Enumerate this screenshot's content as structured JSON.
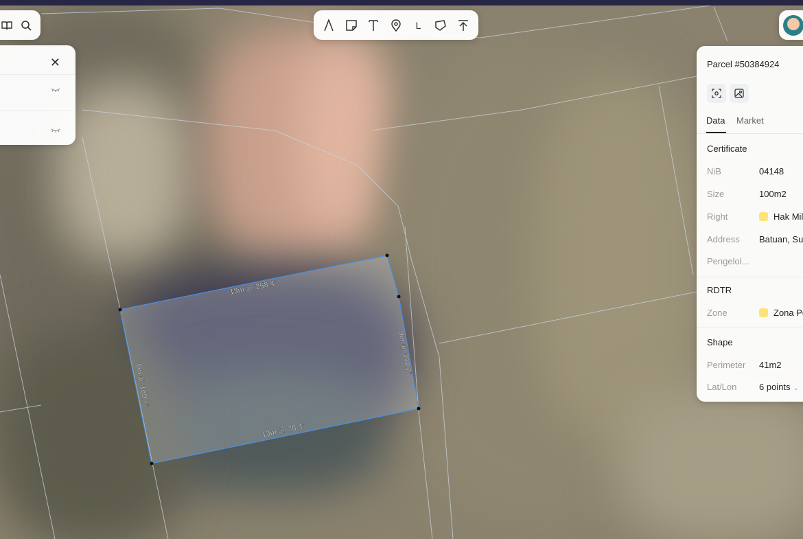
{
  "toolbar": {
    "tools": [
      "freehand-tool",
      "note-tool",
      "text-tool",
      "pin-tool",
      "line-tool",
      "polygon-tool",
      "upload-tool"
    ],
    "line_label": "L"
  },
  "polygon": {
    "top_edge_label": "13m @ 258.4°",
    "right_edge_label": "9m @ 349.7°",
    "bottom_edge_label": "13m @ 78.4°",
    "left_edge_label": "9m @ 169.7°"
  },
  "parcel": {
    "title": "Parcel #50384924",
    "tabs": [
      "Data",
      "Market"
    ],
    "certificate": {
      "section": "Certificate",
      "nib_label": "NiB",
      "nib_value": "04148",
      "size_label": "Size",
      "size_value": "100m2",
      "right_label": "Right",
      "right_value": "Hak Mil",
      "address_label": "Address",
      "address_value": "Batuan, Su",
      "pengelola_label": "Pengelol..."
    },
    "rdtr": {
      "section": "RDTR",
      "zone_label": "Zone",
      "zone_value": "Zona Pe"
    },
    "shape": {
      "section": "Shape",
      "perimeter_label": "Perimeter",
      "perimeter_value": "41m2",
      "latlon_label": "Lat/Lon",
      "latlon_value": "6 points"
    }
  },
  "colors": {
    "accent": "#4a90e2",
    "badge": "#fde47a",
    "topbar": "#272645"
  }
}
